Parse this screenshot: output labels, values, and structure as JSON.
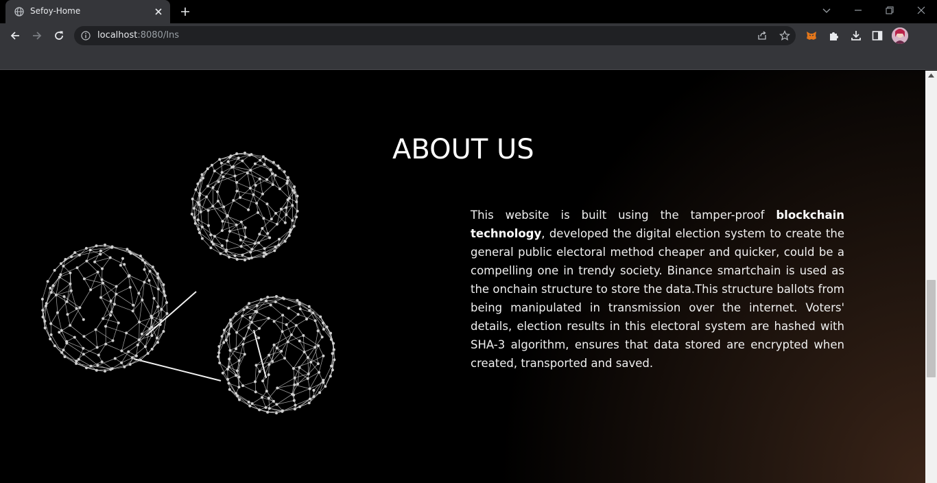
{
  "browser": {
    "tab_title": "Sefoy-Home",
    "url_host": "localhost",
    "url_rest": ":8080/Ins"
  },
  "page": {
    "heading": "ABOUT US",
    "text_part1": "This website is built using the tamper-proof ",
    "text_bold": "blockchain technology",
    "text_part2": ", developed the digital election system to create the general public electoral method cheaper and quicker, could be a compelling one in trendy society. Binance smartchain is used as the onchain structure to store the data.This structure ballots from being manipulated in transmission over the internet. Voters' details, election results in this electoral system are hashed with SHA-3 algorithm, ensures that data stored are encrypted when created, transported and saved."
  },
  "icons": [
    "globe-icon",
    "close-icon",
    "plus-icon",
    "chevron-down-icon",
    "minimize-icon",
    "restore-icon",
    "window-close-icon",
    "back-icon",
    "forward-icon",
    "reload-icon",
    "info-icon",
    "share-icon",
    "star-icon",
    "metamask-icon",
    "extensions-icon",
    "download-icon",
    "side-panel-icon",
    "avatar"
  ],
  "colors": {
    "chrome_bg": "#35363a",
    "page_bg": "#000000",
    "glow": "#3a2418"
  }
}
